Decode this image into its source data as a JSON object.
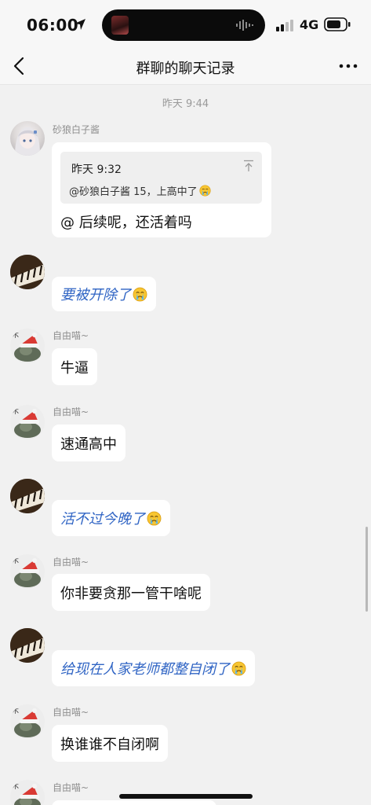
{
  "status_bar": {
    "time": "06:00",
    "network": "4G",
    "icons": [
      "location-arrow-icon",
      "signal-icon",
      "battery-icon"
    ]
  },
  "nav": {
    "title": "群聊的聊天记录",
    "back_icon": "chevron-left-icon",
    "more_icon": "ellipsis-icon"
  },
  "chat": {
    "timestamp": "昨天 9:44",
    "messages": [
      {
        "sender": "砂狼白子酱",
        "avatar": "anime-avatar",
        "quote": {
          "time": "昨天 9:32",
          "text": "@砂狼白子酱 15，上高中了"
        },
        "text": "@  后续呢，还活着吗"
      },
      {
        "sender": "",
        "avatar": "piano-avatar",
        "text": "要被开除了",
        "emoji": "crying-emoji"
      },
      {
        "sender": "自由喵~",
        "avatar": "cat-avatar",
        "text": "牛逼"
      },
      {
        "sender": "自由喵~",
        "avatar": "cat-avatar",
        "text": "速通高中"
      },
      {
        "sender": "",
        "avatar": "piano-avatar",
        "text": "活不过今晚了",
        "emoji": "crying-emoji"
      },
      {
        "sender": "自由喵~",
        "avatar": "cat-avatar",
        "text": "你非要贪那一管干啥呢"
      },
      {
        "sender": "",
        "avatar": "piano-avatar",
        "text": "给现在人家老师都整自闭了",
        "emoji": "crying-emoji"
      },
      {
        "sender": "自由喵~",
        "avatar": "cat-avatar",
        "text": "换谁谁不自闭啊"
      },
      {
        "sender": "自由喵~",
        "avatar": "cat-avatar",
        "text": ""
      }
    ]
  },
  "colors": {
    "background": "#f1f1f1",
    "bubble": "#ffffff",
    "blue_text": "#2f64c4",
    "meta_text": "#9a9a9a"
  }
}
